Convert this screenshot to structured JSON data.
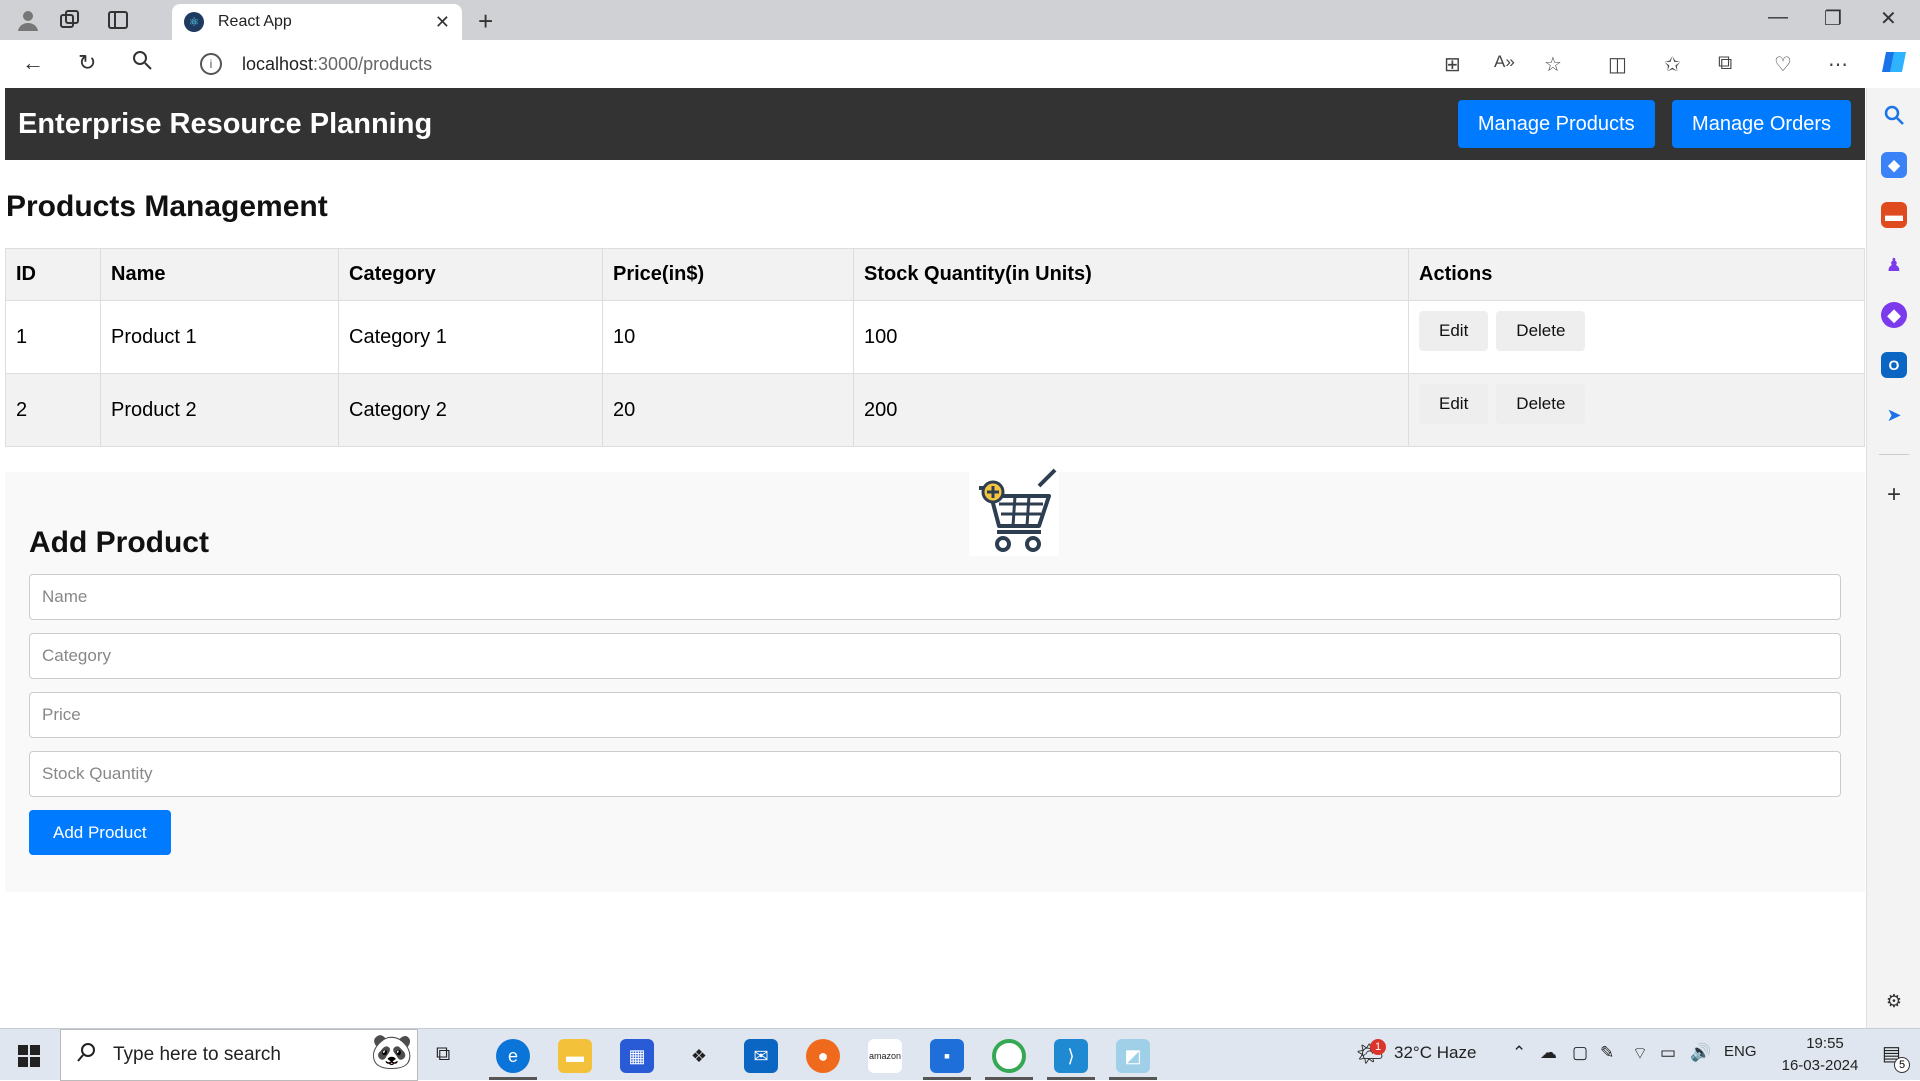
{
  "browser": {
    "tab_title": "React App",
    "url_host": "localhost",
    "url_path": ":3000/products",
    "favicon": "react-icon"
  },
  "header": {
    "title": "Enterprise Resource Planning",
    "nav": [
      "Manage Products",
      "Manage Orders"
    ]
  },
  "products": {
    "title": "Products Management",
    "columns": [
      "ID",
      "Name",
      "Category",
      "Price(in$)",
      "Stock Quantity(in Units)",
      "Actions"
    ],
    "rows": [
      {
        "id": "1",
        "name": "Product 1",
        "category": "Category 1",
        "price": "10",
        "stock": "100"
      },
      {
        "id": "2",
        "name": "Product 2",
        "category": "Category 2",
        "price": "20",
        "stock": "200"
      }
    ],
    "edit_label": "Edit",
    "delete_label": "Delete"
  },
  "add_form": {
    "title": "Add Product",
    "placeholders": {
      "name": "Name",
      "category": "Category",
      "price": "Price",
      "stock": "Stock Quantity"
    },
    "submit_label": "Add Product",
    "image": "shopping-cart-plus-icon"
  },
  "taskbar": {
    "search_placeholder": "Type here to search",
    "weather": "32°C  Haze",
    "weather_badge": "1",
    "language": "ENG",
    "time": "19:55",
    "date": "16-03-2024",
    "notifications": "5"
  },
  "colors": {
    "header_bg": "#333333",
    "primary": "#007bff"
  }
}
